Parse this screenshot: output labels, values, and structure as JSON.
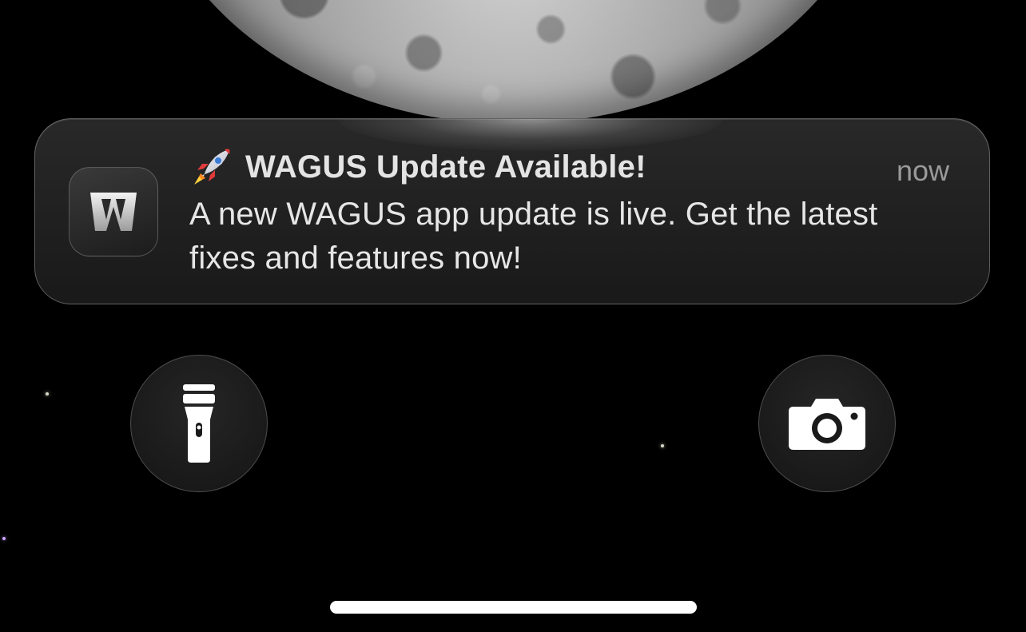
{
  "wallpaper": {
    "subject": "moon"
  },
  "notification": {
    "app_icon": "wagus-app-icon",
    "app_icon_letter": "W",
    "emoji": "🚀",
    "title": "WAGUS Update Available!",
    "time": "now",
    "body": "A new WAGUS app update is live. Get the latest fixes and features now!"
  },
  "quick_actions": {
    "left_icon": "flashlight-icon",
    "right_icon": "camera-icon"
  },
  "colors": {
    "background": "#000000",
    "notification_bg": "#222222",
    "title_text": "#e4e4e4",
    "time_text": "#9a9a9a",
    "home_indicator": "#ffffff"
  }
}
